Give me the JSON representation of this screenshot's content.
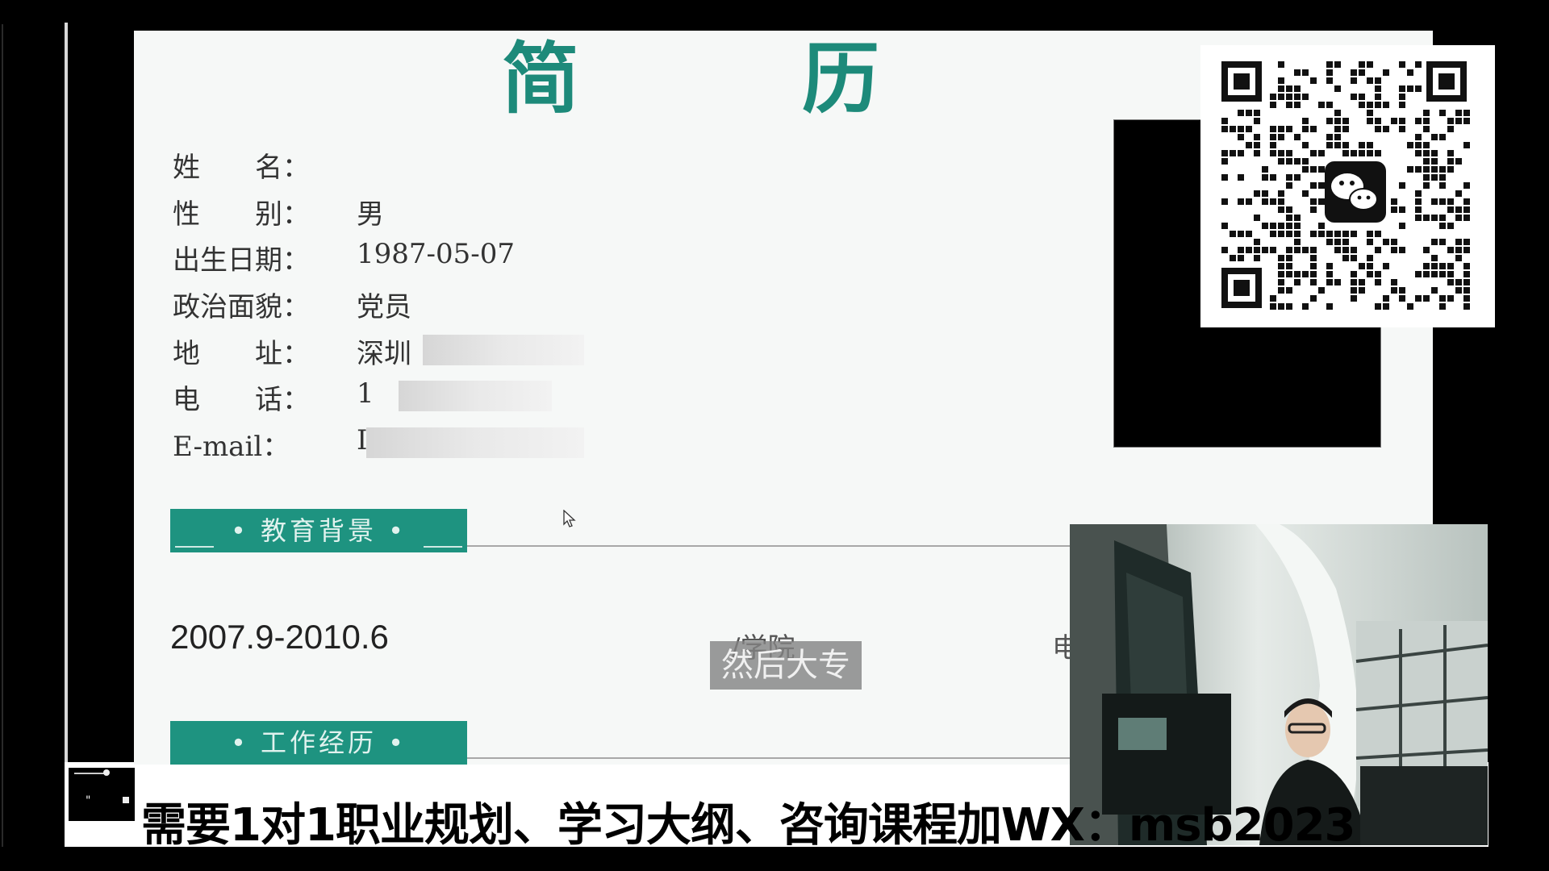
{
  "resume": {
    "title": "简　历",
    "fields": [
      {
        "label": "姓　　名：",
        "value": ""
      },
      {
        "label": "性　　别：",
        "value": "男"
      },
      {
        "label": "出生日期：",
        "value": "1987-05-07"
      },
      {
        "label": "政治面貌：",
        "value": "党员"
      },
      {
        "label": "地　　址：",
        "value": "深圳"
      },
      {
        "label": "电　　话：",
        "value": "1"
      },
      {
        "label": "E-mail：",
        "value": "I"
      }
    ],
    "education_heading": "• 教育背景 •",
    "education": {
      "date": "2007.9-2010.6",
      "school": "/学院",
      "major": "电"
    },
    "work_heading": "• 工作经历 •"
  },
  "subtitle": "然后大专",
  "banner": "需要1对1职业规划、学习大纲、咨询课程加WX：msb2023",
  "colors": {
    "accent": "#1e9380",
    "title": "#1d8a7a",
    "background": "#000000"
  },
  "icons": {
    "qr": "qr-code-icon",
    "wechat": "wechat-icon",
    "cursor": "mouse-cursor-icon"
  }
}
